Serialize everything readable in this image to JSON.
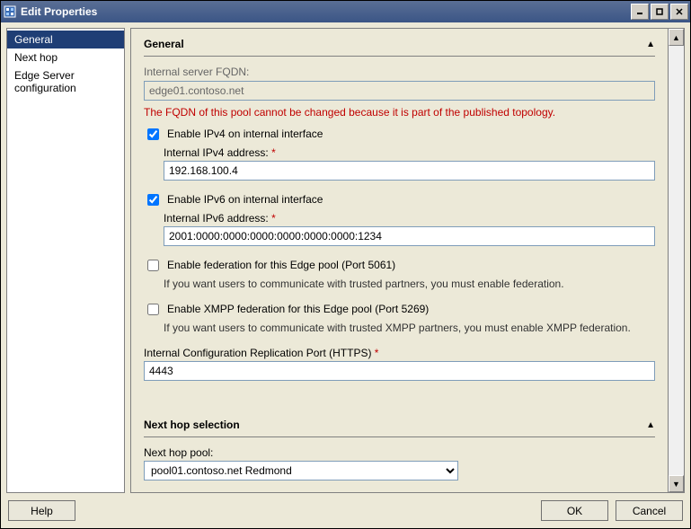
{
  "window": {
    "title": "Edit Properties"
  },
  "sidebar": {
    "items": [
      {
        "label": "General",
        "selected": true
      },
      {
        "label": "Next hop",
        "selected": false
      },
      {
        "label": "Edge Server configuration",
        "selected": false
      }
    ]
  },
  "general": {
    "header": "General",
    "fqdn_label": "Internal server FQDN:",
    "fqdn_value": "edge01.contoso.net",
    "fqdn_warning": "The FQDN of this pool cannot be changed because it is part of the published topology.",
    "ipv4": {
      "checkbox_label": "Enable IPv4 on internal interface",
      "checked": true,
      "addr_label": "Internal IPv4 address:",
      "addr_value": "192.168.100.4"
    },
    "ipv6": {
      "checkbox_label": "Enable IPv6 on internal interface",
      "checked": true,
      "addr_label": "Internal IPv6 address:",
      "addr_value": "2001:0000:0000:0000:0000:0000:0000:1234"
    },
    "federation": {
      "checkbox_label": "Enable federation for this Edge pool (Port 5061)",
      "checked": false,
      "note": "If you want users to communicate with trusted partners, you must enable federation."
    },
    "xmpp": {
      "checkbox_label": "Enable XMPP federation for this Edge pool (Port 5269)",
      "checked": false,
      "note": "If you want users to communicate with trusted XMPP partners, you must enable XMPP federation."
    },
    "repl_port": {
      "label": "Internal Configuration Replication Port (HTTPS)",
      "value": "4443"
    }
  },
  "nexthop": {
    "header": "Next hop selection",
    "pool_label": "Next hop pool:",
    "pool_value": "pool01.contoso.net   Redmond"
  },
  "footer": {
    "help": "Help",
    "ok": "OK",
    "cancel": "Cancel"
  },
  "required_marker": "*"
}
